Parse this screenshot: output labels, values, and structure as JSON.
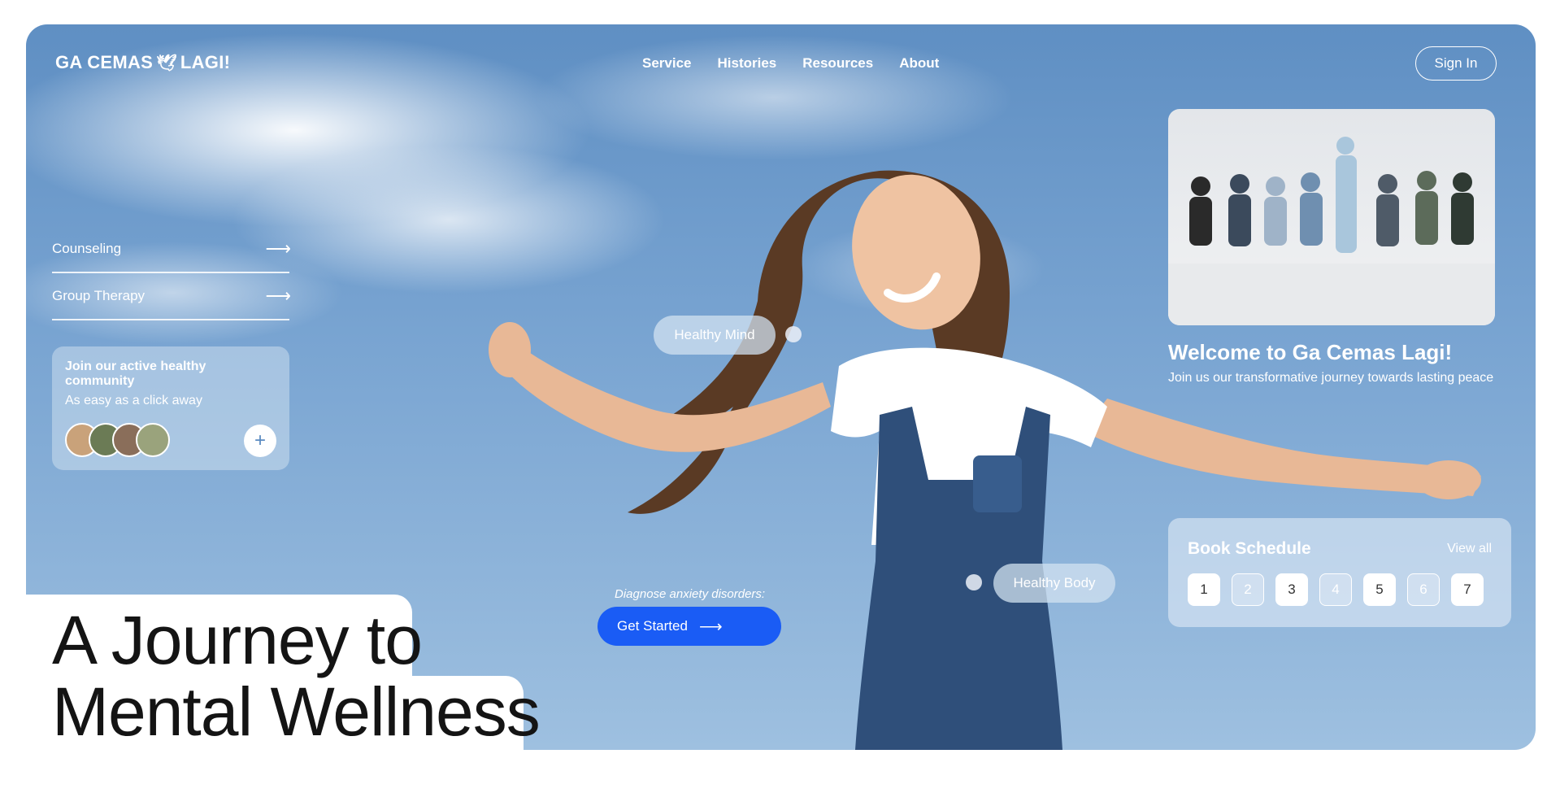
{
  "brand": {
    "name_left": "GA CEMAS",
    "name_right": "LAGI!",
    "logo_icon": "bird-icon"
  },
  "nav": {
    "items": [
      "Service",
      "Histories",
      "Resources",
      "About"
    ],
    "signin_label": "Sign In"
  },
  "services": [
    {
      "label": "Counseling",
      "icon": "arrow-right-icon"
    },
    {
      "label": "Group Therapy",
      "icon": "arrow-right-icon"
    }
  ],
  "community": {
    "title": "Join our active healthy community",
    "subtitle": "As easy as a click away",
    "avatar_colors": [
      "#c9a27a",
      "#6b7b55",
      "#8a6e5a",
      "#9aa37c"
    ],
    "add_icon": "plus-icon"
  },
  "tags": {
    "healthy_mind": "Healthy Mind",
    "healthy_body": "Healthy Body"
  },
  "cta": {
    "diagnose_label": "Diagnose anxiety disorders:",
    "button_label": "Get Started",
    "icon": "arrow-right-icon"
  },
  "welcome": {
    "title": "Welcome to Ga Cemas Lagi!",
    "subtitle": "Join us our transformative journey towards lasting peace"
  },
  "schedule": {
    "title": "Book Schedule",
    "view_all": "View all",
    "days": [
      {
        "label": "1",
        "available": true
      },
      {
        "label": "2",
        "available": false
      },
      {
        "label": "3",
        "available": true
      },
      {
        "label": "4",
        "available": false
      },
      {
        "label": "5",
        "available": true
      },
      {
        "label": "6",
        "available": false
      },
      {
        "label": "7",
        "available": true
      }
    ]
  },
  "headline": {
    "line1": "A Journey to",
    "line2": "Mental Wellness"
  },
  "colors": {
    "cta_blue": "#1a5cf5",
    "sky": "#7aa5d2"
  }
}
